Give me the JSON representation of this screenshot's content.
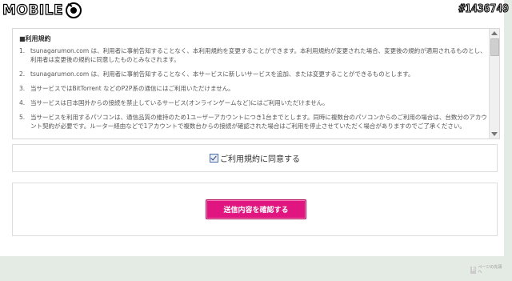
{
  "watermark": {
    "logo_text": "MOBILE",
    "id_text": "#1436749"
  },
  "terms": {
    "heading": "■利用規約",
    "items": [
      {
        "num": "1.",
        "text": "tsunagarumon.com は、利用者に事前告知することなく、本利用規約を変更することができます。本利用規約が変更された場合、変更後の規約が適用されるものとし、利用者は変更後の規約に同意したものとみなされます。"
      },
      {
        "num": "2.",
        "text": "tsunagarumon.com は、利用者に事前告知することなく、本サービスに新しいサービスを追加、または変更することができるものとします。"
      },
      {
        "num": "3.",
        "text": "当サービスではBitTorrent などのP2P系の通信にはご利用いただけません。"
      },
      {
        "num": "4.",
        "text": "当サービスは日本国外からの接続を禁止しているサービス(オンラインゲームなど)にはご利用いただけません。"
      },
      {
        "num": "5.",
        "text": "当サービスを利用するパソコンは、通信品質の維持のため1ユーザーアカウントにつき1台までとします。同時に複数台のパソコンからのご利用の場合は、台数分のアカウント契約が必要です。ルーター経由などで1アカウントで複数台からの接続が確認された場合はご利用を停止させていただく場合がありますのでご了承ください。"
      }
    ]
  },
  "agree": {
    "label": "ご利用規約に同意する",
    "checked": true
  },
  "confirm": {
    "button_label": "送信内容を確認する",
    "button_color": "#e0157f"
  },
  "page_top": {
    "icon_text": "B",
    "label": "ページの先頭へ"
  }
}
